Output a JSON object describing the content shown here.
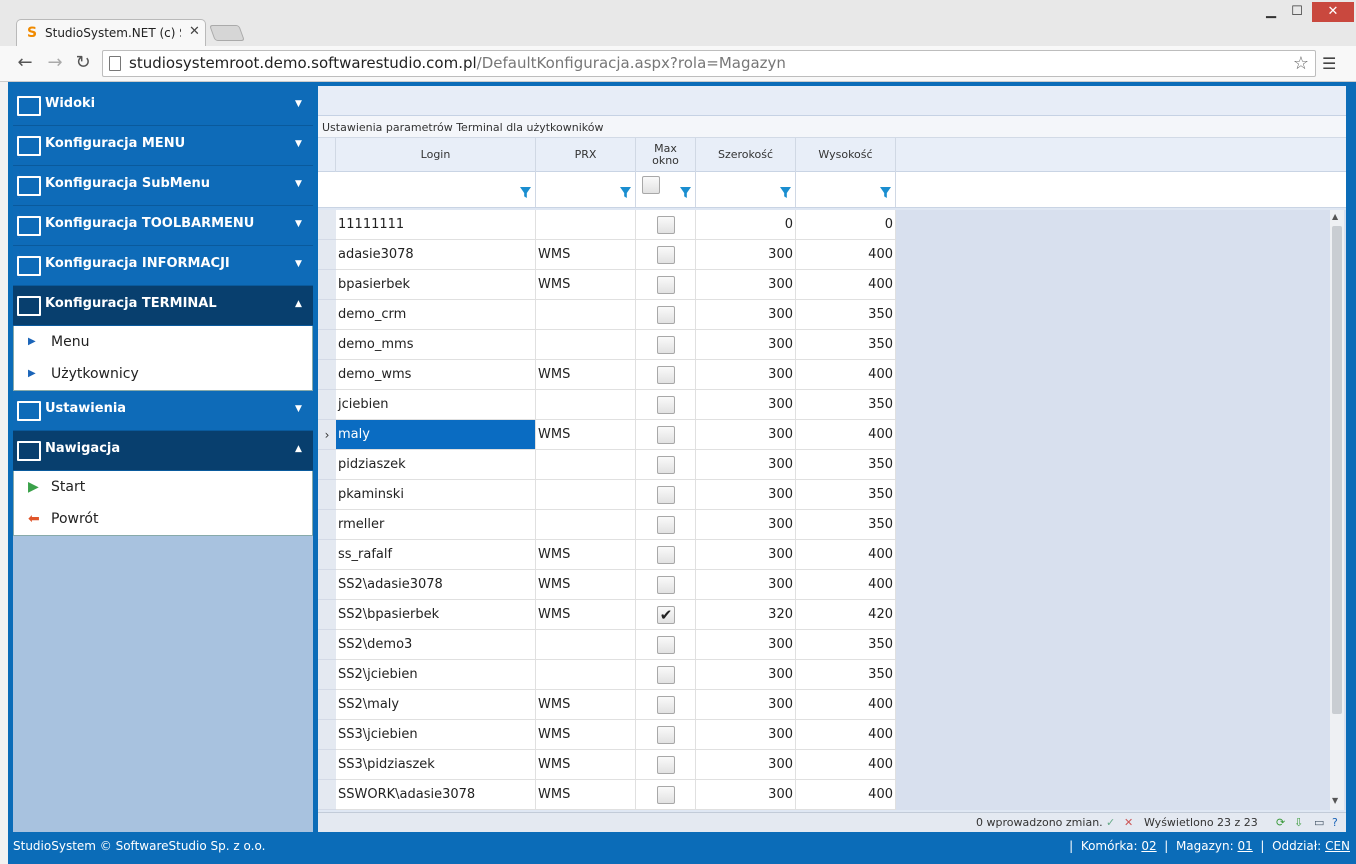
{
  "browser": {
    "tab_title": "StudioSystem.NET (c) Soft",
    "url_host": "studiosystemroot.demo.softwarestudio.com.pl",
    "url_path": "/DefaultKonfiguracja.aspx?rola=Magazyn"
  },
  "sidebar": {
    "sections": [
      {
        "label": "Widoki",
        "open": false
      },
      {
        "label": "Konfiguracja MENU",
        "open": false
      },
      {
        "label": "Konfiguracja SubMenu",
        "open": false
      },
      {
        "label": "Konfiguracja TOOLBARMENU",
        "open": false
      },
      {
        "label": "Konfiguracja INFORMACJI",
        "open": false
      },
      {
        "label": "Konfiguracja TERMINAL",
        "open": true
      },
      {
        "label": "Ustawienia",
        "open": false
      },
      {
        "label": "Nawigacja",
        "open": true
      }
    ],
    "terminal_items": [
      "Menu",
      "Użytkownicy"
    ],
    "nav_items": [
      "Start",
      "Powrót"
    ]
  },
  "grid": {
    "caption": "Ustawienia parametrów Terminal dla użytkowników",
    "columns": [
      "Login",
      "PRX",
      "Max\nokno",
      "Szerokość",
      "Wysokość"
    ],
    "rows": [
      [
        "11111111",
        "",
        false,
        "0",
        "0"
      ],
      [
        "adasie3078",
        "WMS",
        false,
        "300",
        "400"
      ],
      [
        "bpasierbek",
        "WMS",
        false,
        "300",
        "400"
      ],
      [
        "demo_crm",
        "",
        false,
        "300",
        "350"
      ],
      [
        "demo_mms",
        "",
        false,
        "300",
        "350"
      ],
      [
        "demo_wms",
        "WMS",
        false,
        "300",
        "400"
      ],
      [
        "jciebien",
        "",
        false,
        "300",
        "350"
      ],
      [
        "maly",
        "WMS",
        false,
        "300",
        "400"
      ],
      [
        "pidziaszek",
        "",
        false,
        "300",
        "350"
      ],
      [
        "pkaminski",
        "",
        false,
        "300",
        "350"
      ],
      [
        "rmeller",
        "",
        false,
        "300",
        "350"
      ],
      [
        "ss_rafalf",
        "WMS",
        false,
        "300",
        "400"
      ],
      [
        "SS2\\adasie3078",
        "WMS",
        false,
        "300",
        "400"
      ],
      [
        "SS2\\bpasierbek",
        "WMS",
        true,
        "320",
        "420"
      ],
      [
        "SS2\\demo3",
        "",
        false,
        "300",
        "350"
      ],
      [
        "SS2\\jciebien",
        "",
        false,
        "300",
        "350"
      ],
      [
        "SS2\\maly",
        "WMS",
        false,
        "300",
        "400"
      ],
      [
        "SS3\\jciebien",
        "WMS",
        false,
        "300",
        "400"
      ],
      [
        "SS3\\pidziaszek",
        "WMS",
        false,
        "300",
        "400"
      ],
      [
        "SSWORK\\adasie3078",
        "WMS",
        false,
        "300",
        "400"
      ]
    ],
    "selected_row": 7,
    "status_changes": "0 wprowadzono zmian.",
    "status_shown": "Wyświetlono 23 z 23"
  },
  "footer": {
    "copyright": "StudioSystem © SoftwareStudio Sp. z o.o.",
    "komorka_label": "Komórka:",
    "komorka": "02",
    "magazyn_label": "Magazyn:",
    "magazyn": "01",
    "oddzial_label": "Oddział:",
    "oddzial": "CEN"
  }
}
